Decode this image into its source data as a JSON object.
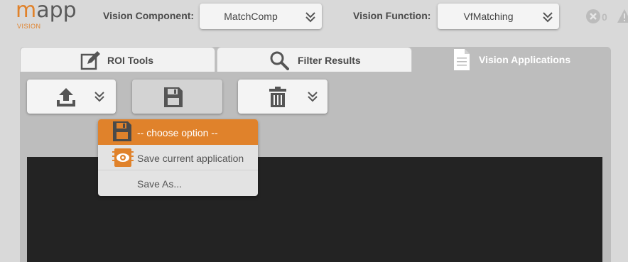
{
  "logo": {
    "main_a": "m",
    "main_b": "app",
    "sub": "VISION"
  },
  "header": {
    "component_label": "Vision Component:",
    "component_value": "MatchComp",
    "function_label": "Vision Function:",
    "function_value": "VfMatching",
    "error_count": "0"
  },
  "tabs": [
    {
      "label": "ROI Tools",
      "icon": "edit-icon",
      "active": false
    },
    {
      "label": "Filter Results",
      "icon": "search-icon",
      "active": false
    },
    {
      "label": "Vision Applications",
      "icon": "document-icon",
      "active": true
    }
  ],
  "toolbar": [
    {
      "name": "upload",
      "icon": "upload-icon",
      "has_menu": true
    },
    {
      "name": "save",
      "icon": "save-icon",
      "has_menu": false,
      "pressed": true
    },
    {
      "name": "delete",
      "icon": "trash-icon",
      "has_menu": true
    }
  ],
  "dropdown": {
    "items": [
      {
        "label": "-- choose option --",
        "icon": "save-icon",
        "selected": true
      },
      {
        "label": "Save current application",
        "icon": "vision-eye-icon",
        "selected": false
      },
      {
        "label": "Save As...",
        "icon": "",
        "selected": false
      }
    ]
  },
  "colors": {
    "accent": "#e0822b",
    "header_bg": "#d9d9d9",
    "panel_bg": "#bdbdbd",
    "canvas_bg": "#232323",
    "text": "#4a4a4a"
  }
}
